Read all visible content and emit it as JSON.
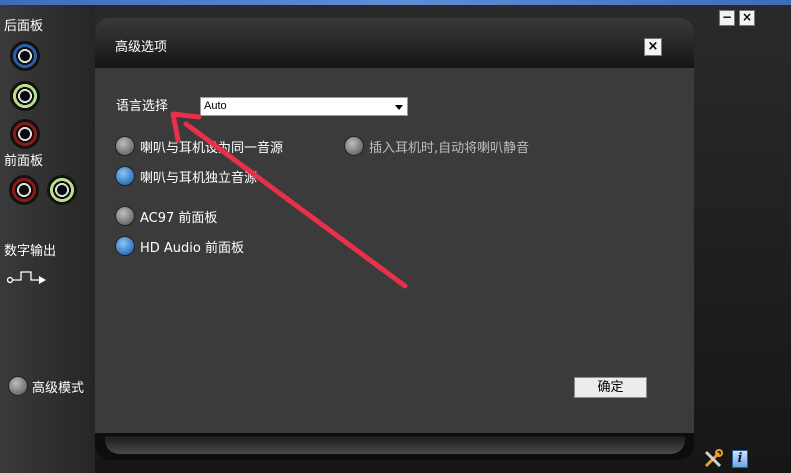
{
  "left_panel": {
    "back_panel_label": "后面板",
    "front_panel_label": "前面板",
    "digital_output_label": "数字输出",
    "advanced_mode_label": "高级模式",
    "jack_colors": {
      "blue": "#2b5fa8",
      "green": "#b7e08a",
      "red": "#8a1a1a"
    }
  },
  "window_controls": {
    "minimize": "−",
    "close": "×"
  },
  "dialog": {
    "title": "高级选项",
    "close": "×",
    "language_label": "语言选择",
    "language_value": "Auto",
    "options": {
      "same_source": "喇叭与耳机设为同一音源",
      "independent_source": "喇叭与耳机独立音源",
      "mute_on_plug": "插入耳机时,自动将喇叭静音",
      "ac97": "AC97 前面板",
      "hd_audio": "HD Audio 前面板"
    },
    "ok_button": "确定"
  },
  "footer_icons": {
    "info": "i"
  },
  "colors": {
    "accent_blue": "#3c7fc8",
    "annotation_arrow": "#e8304a"
  }
}
